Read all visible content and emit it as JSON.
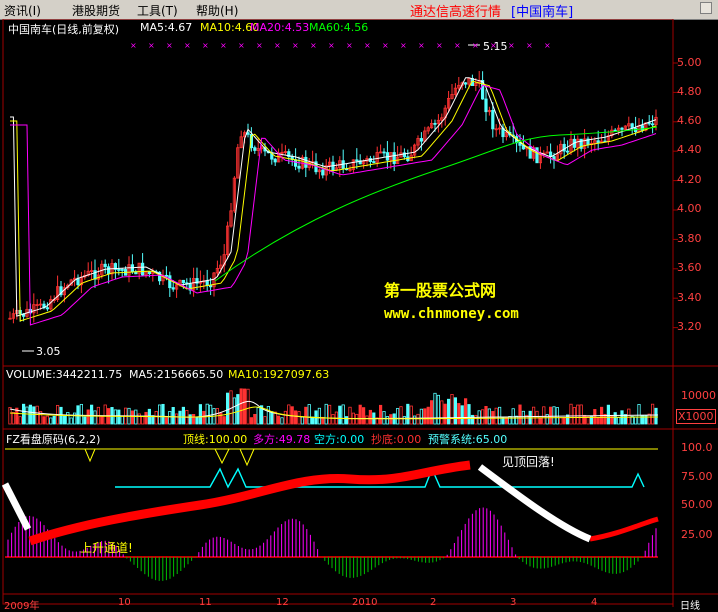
{
  "menu": {
    "items": [
      "资讯(I)",
      "港股期货",
      "工具(T)",
      "帮助(H)"
    ],
    "window_title": "通达信高速行情",
    "stock_tag": "[中国南车]"
  },
  "price_panel": {
    "stock_label": "中国南车(日线,前复权)",
    "ma5": "MA5:4.67",
    "ma10": "MA10:4.60",
    "ma20": "MA20:4.53",
    "ma60": "MA60:4.56",
    "axis_ticks": [
      "5.00",
      "4.80",
      "4.60",
      "4.40",
      "4.20",
      "4.00",
      "3.80",
      "3.60",
      "3.40",
      "3.20"
    ],
    "high_marker": "5.15",
    "low_marker": "3.05",
    "watermark_name": "第一股票公式网",
    "watermark_url": "www.chnmoney.com",
    "colors": {
      "up": "#ff3232",
      "down": "#54ffff",
      "ma5": "#ffffff",
      "ma10": "#ffff00",
      "ma20": "#ff00ff",
      "ma60": "#00ff00"
    }
  },
  "volume_panel": {
    "label": "VOLUME:3442211.75",
    "ma5": "MA5:2156665.50",
    "ma10": "MA10:1927097.63",
    "axis_tick": "10000",
    "unit": "X1000"
  },
  "indicator_panel": {
    "name": "FZ看盘原码(6,2,2)",
    "top": "顶线:100.00",
    "long": "多方:49.78",
    "short": "空方:0.00",
    "bottom": "抄底:0.00",
    "warn": "预警系统:65.00",
    "axis_ticks": [
      "100.0",
      "75.00",
      "50.00",
      "25.00"
    ],
    "note_top": "见顶回落!",
    "note_channel": "上升通道!"
  },
  "time_axis": {
    "labels": [
      "2009年",
      "10",
      "11",
      "12",
      "2010",
      "2",
      "3",
      "4"
    ],
    "period": "日线"
  }
}
